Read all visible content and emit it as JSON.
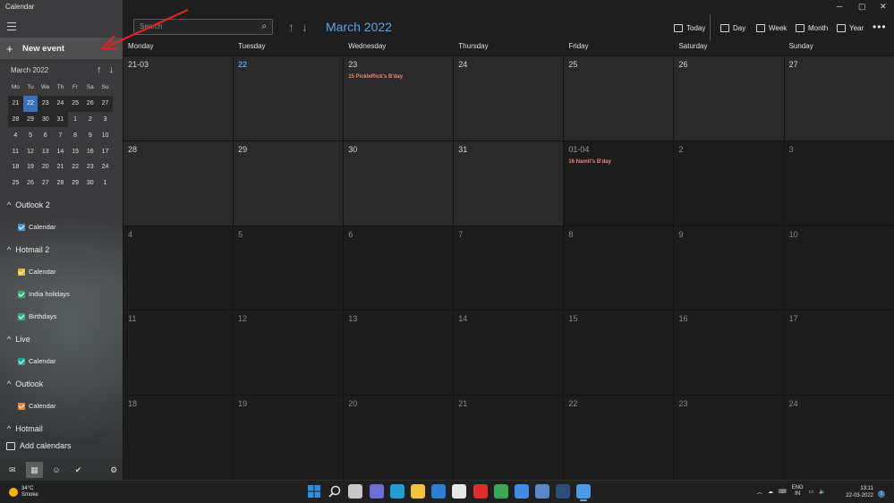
{
  "window": {
    "title": "Calendar"
  },
  "sidebar": {
    "new_event_label": "New event",
    "mini_calendar": {
      "title": "March 2022",
      "days_of_week": [
        "Mo",
        "Tu",
        "We",
        "Th",
        "Fr",
        "Sa",
        "Su"
      ],
      "weeks": [
        [
          "21",
          "22",
          "23",
          "24",
          "25",
          "26",
          "27"
        ],
        [
          "28",
          "29",
          "30",
          "31",
          "1",
          "2",
          "3"
        ],
        [
          "4",
          "5",
          "6",
          "7",
          "8",
          "9",
          "10"
        ],
        [
          "11",
          "12",
          "13",
          "14",
          "15",
          "16",
          "17"
        ],
        [
          "18",
          "19",
          "20",
          "21",
          "22",
          "23",
          "24"
        ],
        [
          "25",
          "26",
          "27",
          "28",
          "29",
          "30",
          "1"
        ]
      ]
    },
    "accounts": [
      {
        "name": "Outlook 2",
        "calendars": [
          {
            "name": "Calendar",
            "color": "#4a8fd8"
          }
        ]
      },
      {
        "name": "Hotmail 2",
        "calendars": [
          {
            "name": "Calendar",
            "color": "#e8b23a"
          },
          {
            "name": "India holidays",
            "color": "#2fb07a"
          },
          {
            "name": "Birthdays",
            "color": "#2fb07a"
          }
        ]
      },
      {
        "name": "Live",
        "calendars": [
          {
            "name": "Calendar",
            "color": "#22a89a"
          }
        ]
      },
      {
        "name": "Outlook",
        "calendars": [
          {
            "name": "Calendar",
            "color": "#e9823a"
          }
        ]
      },
      {
        "name": "Hotmail",
        "calendars": []
      }
    ],
    "add_calendars_label": "Add calendars",
    "bottom_nav": [
      {
        "icon": "mail-icon",
        "glyph": "✉"
      },
      {
        "icon": "calendar-icon",
        "glyph": "▦"
      },
      {
        "icon": "people-icon",
        "glyph": "☺"
      },
      {
        "icon": "todo-icon",
        "glyph": "✔"
      },
      {
        "icon": "settings-icon",
        "glyph": "⚙"
      }
    ]
  },
  "header": {
    "search_placeholder": "Search",
    "month_title": "March 2022",
    "views": [
      "Today",
      "Day",
      "Week",
      "Month",
      "Year"
    ],
    "more_label": "•••"
  },
  "calendar": {
    "days_of_week": [
      "Monday",
      "Tuesday",
      "Wednesday",
      "Thursday",
      "Friday",
      "Saturday",
      "Sunday"
    ],
    "weeks": [
      [
        "21-03",
        "22",
        "23",
        "24",
        "25",
        "26",
        "27"
      ],
      [
        "28",
        "29",
        "30",
        "31",
        "01-04",
        "2",
        "3"
      ],
      [
        "4",
        "5",
        "6",
        "7",
        "8",
        "9",
        "10"
      ],
      [
        "11",
        "12",
        "13",
        "14",
        "15",
        "16",
        "17"
      ],
      [
        "18",
        "19",
        "20",
        "21",
        "22",
        "23",
        "24"
      ]
    ],
    "events": [
      {
        "text": "15 PickleRick's B'day",
        "week": 0,
        "day": 2
      },
      {
        "text": "16 Namit's B'day",
        "week": 1,
        "day": 4
      }
    ]
  },
  "taskbar": {
    "weather_temp": "34°C",
    "weather_desc": "Smoke",
    "language_line1": "ENG",
    "language_line2": "IN",
    "time": "13:11",
    "date": "22-03-2022",
    "notification_count": "1",
    "apps": [
      {
        "icon": "windows-start-icon",
        "color": "#2b8fe6"
      },
      {
        "icon": "search-icon",
        "color": "#e0e0e0"
      },
      {
        "icon": "task-view-icon",
        "color": "#c8c8c8"
      },
      {
        "icon": "teams-chat-icon",
        "color": "#6e6fd6"
      },
      {
        "icon": "edge-browser-icon",
        "color": "#1e9ed6"
      },
      {
        "icon": "file-explorer-icon",
        "color": "#f2c23a"
      },
      {
        "icon": "mail-app-icon",
        "color": "#2b7fd6"
      },
      {
        "icon": "store-icon",
        "color": "#e8e8e8"
      },
      {
        "icon": "opera-browser-icon",
        "color": "#e22b2b"
      },
      {
        "icon": "chrome-browser-icon",
        "color": "#3aa757"
      },
      {
        "icon": "files-app-icon",
        "color": "#3b8de6"
      },
      {
        "icon": "qbittorrent-icon",
        "color": "#5b86c9"
      },
      {
        "icon": "steam-icon",
        "color": "#2a4d7a"
      },
      {
        "icon": "calendar-app-icon",
        "color": "#4a9ae6"
      }
    ]
  }
}
